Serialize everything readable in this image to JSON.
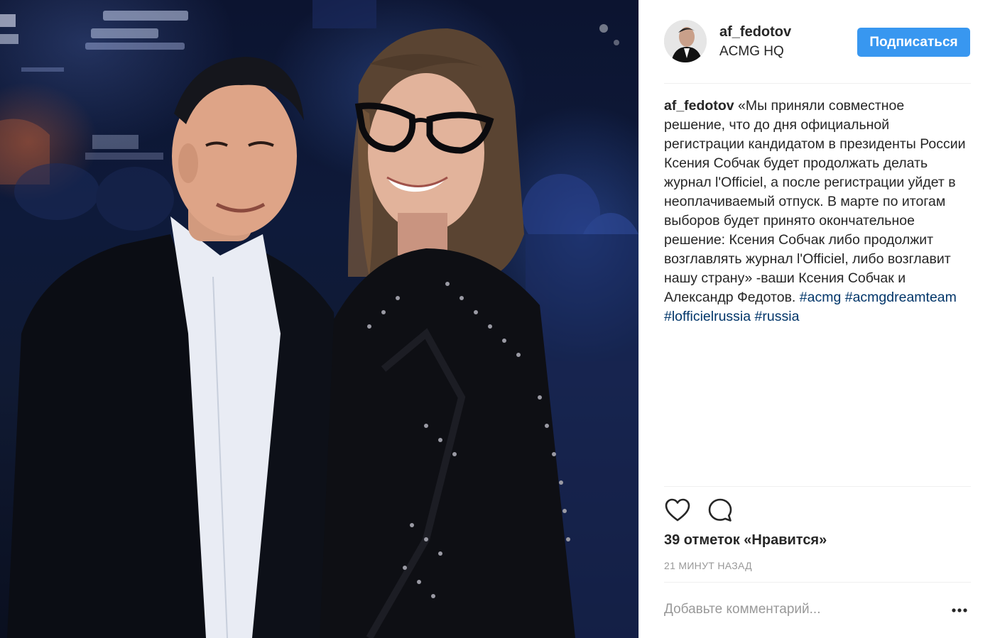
{
  "post": {
    "username": "af_fedotov",
    "location": "ACMG HQ",
    "follow_label": "Подписаться",
    "caption": {
      "username": "af_fedotov",
      "text": " «Мы приняли совместное решение, что до дня официальной регистрации кандидатом в президенты России Ксения Собчак будет продолжать делать журнал l'Officiel, а после регистрации уйдет в неоплачиваемый отпуск. В марте по итогам выборов будет принято окончательное решение: Ксения Собчак либо продолжит возглавлять журнал l'Officiel, либо возглавит нашу страну» -ваши Ксения Собчак и Александр Федотов. ",
      "hashtags": [
        "#acmg",
        "#acmgdreamteam",
        "#lofficielrussia",
        "#russia"
      ]
    },
    "likes": "39 отметок «Нравится»",
    "time": "21 МИНУТ НАЗАД",
    "comment_placeholder": "Добавьте комментарий...",
    "icons": {
      "like": "heart-icon",
      "comment": "comment-bubble-icon",
      "more": "more-options-icon"
    },
    "colors": {
      "accent": "#3897f0",
      "hashtag": "#003569",
      "muted": "#999999",
      "text": "#262626"
    }
  }
}
